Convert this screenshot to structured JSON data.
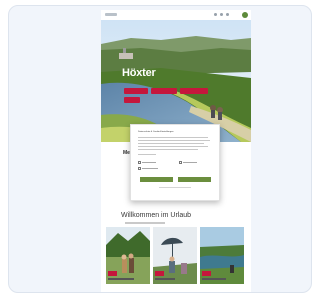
{
  "hero": {
    "title": "Höxter"
  },
  "intro": {
    "heading": "Me"
  },
  "consent": {
    "title": "Datenschutz & Cookie-Einstellungen",
    "buttons": [
      "",
      ""
    ]
  },
  "welcome": {
    "heading": "Willkommen im Urlaub"
  },
  "colors": {
    "accent_red": "#c5173c",
    "consent_green": "#6b8e3e",
    "card_background": "#f1f5fb"
  },
  "icons": [
    "logo-icon",
    "nav-icon",
    "menu-icon",
    "checkbox-icon"
  ]
}
